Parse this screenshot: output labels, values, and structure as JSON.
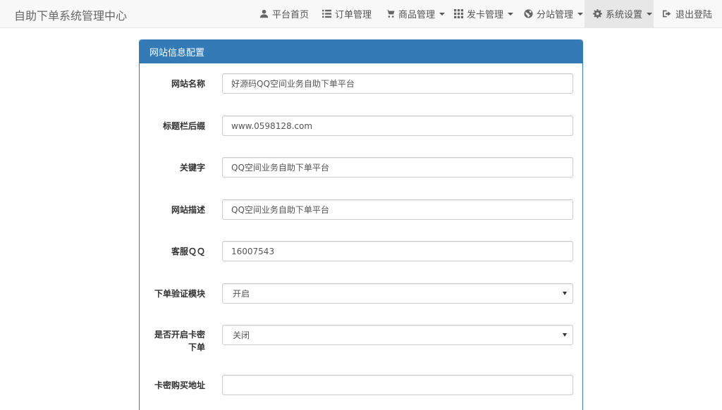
{
  "navbar": {
    "brand": "自助下单系统管理中心",
    "items": [
      {
        "label": "平台首页",
        "icon": "user-icon"
      },
      {
        "label": "订单管理",
        "icon": "list-icon"
      },
      {
        "label": "商品管理",
        "icon": "cart-icon"
      },
      {
        "label": "发卡管理",
        "icon": "grid-icon"
      },
      {
        "label": "分站管理",
        "icon": "globe-icon"
      },
      {
        "label": "系统设置",
        "icon": "gear-icon"
      },
      {
        "label": "退出登陆",
        "icon": "logout-icon"
      }
    ]
  },
  "panel": {
    "title": "网站信息配置",
    "fields": [
      {
        "label": "网站名称",
        "value": "好源码QQ空间业务自助下单平台"
      },
      {
        "label": "标题栏后缀",
        "value": "www.0598128.com"
      },
      {
        "label": "关键字",
        "value": "QQ空间业务自助下单平台"
      },
      {
        "label": "网站描述",
        "value": "QQ空间业务自助下单平台"
      },
      {
        "label": "客服ＱＱ",
        "value": "16007543"
      },
      {
        "label": "下单验证模块",
        "value": "开启"
      },
      {
        "label": "是否开启卡密下单",
        "value": "关闭"
      },
      {
        "label": "卡密购买地址",
        "value": ""
      }
    ]
  },
  "colors": {
    "primary": "#337ab7",
    "navbar_bg": "#f8f8f8",
    "active_bg": "#e7e7e7"
  }
}
